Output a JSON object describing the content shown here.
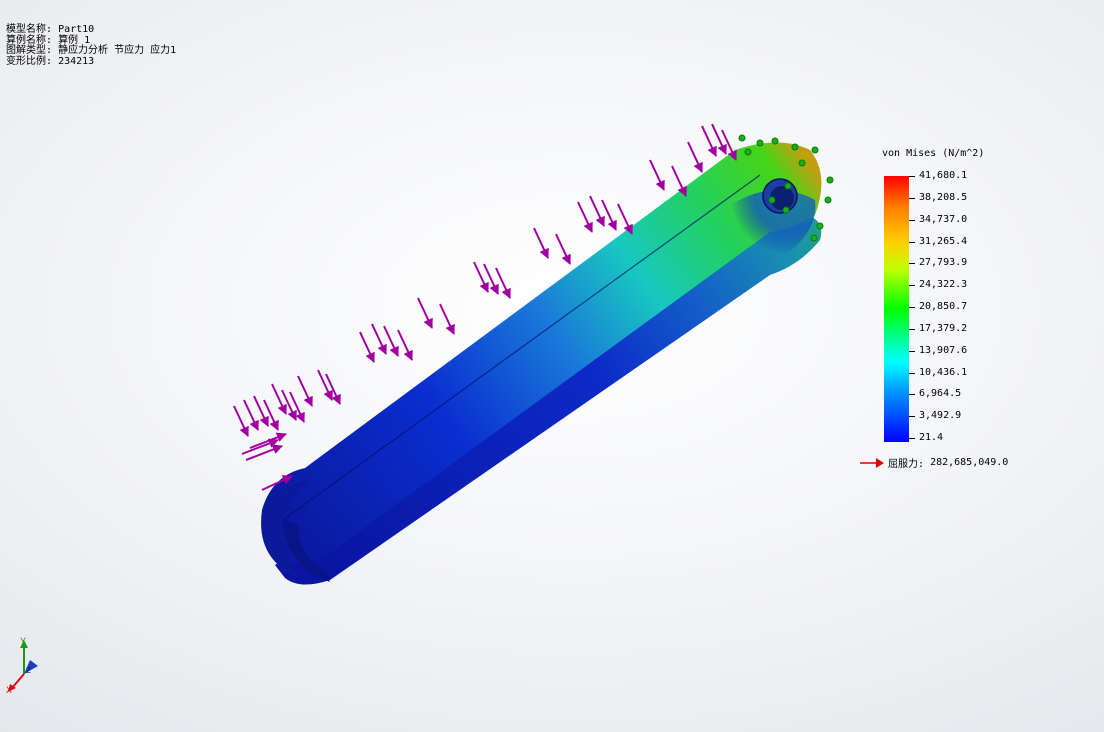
{
  "info": {
    "rows": [
      {
        "label": "模型名称:",
        "value": "Part10"
      },
      {
        "label": "算例名称:",
        "value": "算例 1"
      },
      {
        "label": "图解类型:",
        "value": "静应力分析 节应力 应力1"
      },
      {
        "label": "变形比例:",
        "value": "234213"
      }
    ]
  },
  "legend": {
    "title": "von Mises (N/m^2)",
    "values": [
      "41,680.1",
      "38,208.5",
      "34,737.0",
      "31,265.4",
      "27,793.9",
      "24,322.3",
      "20,850.7",
      "17,379.2",
      "13,907.6",
      "10,436.1",
      "6,964.5",
      "3,492.9",
      "21.4"
    ],
    "yield_label": "屈服力:",
    "yield_value": "282,685,049.0",
    "colors": {
      "max": "#ff0000",
      "mid": "#00ff00",
      "min": "#0000ff"
    }
  },
  "triad": {
    "y": "Y",
    "z": "Z",
    "x": "X"
  },
  "icons": {
    "load": "load-arrow-icon",
    "fixture": "fixture-icon",
    "yield": "yield-arrow-icon"
  }
}
